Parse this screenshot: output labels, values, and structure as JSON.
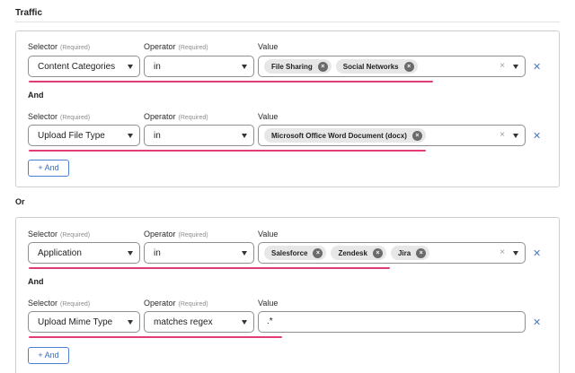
{
  "section": {
    "title": "Traffic"
  },
  "or_label": "Or",
  "and_label": "And",
  "labels": {
    "selector": "Selector",
    "operator": "Operator",
    "value": "Value",
    "required": "(Required)"
  },
  "add_and_label": "+ And",
  "remove_glyph": "✕",
  "chip_remove_glyph": "×",
  "clear_glyph": "×",
  "groups": [
    {
      "rows": [
        {
          "selector": "Content Categories",
          "operator": "in",
          "chips": [
            "File Sharing",
            "Social Networks"
          ]
        },
        {
          "selector": "Upload File Type",
          "operator": "in",
          "chips": [
            "Microsoft Office Word Document (docx)"
          ]
        }
      ]
    },
    {
      "rows": [
        {
          "selector": "Application",
          "operator": "in",
          "chips": [
            "Salesforce",
            "Zendesk",
            "Jira"
          ]
        },
        {
          "selector": "Upload Mime Type",
          "operator": "matches regex",
          "text_value": ".*"
        }
      ]
    }
  ],
  "colors": {
    "underline": "#e23c78",
    "accent": "#4a7fd4"
  }
}
